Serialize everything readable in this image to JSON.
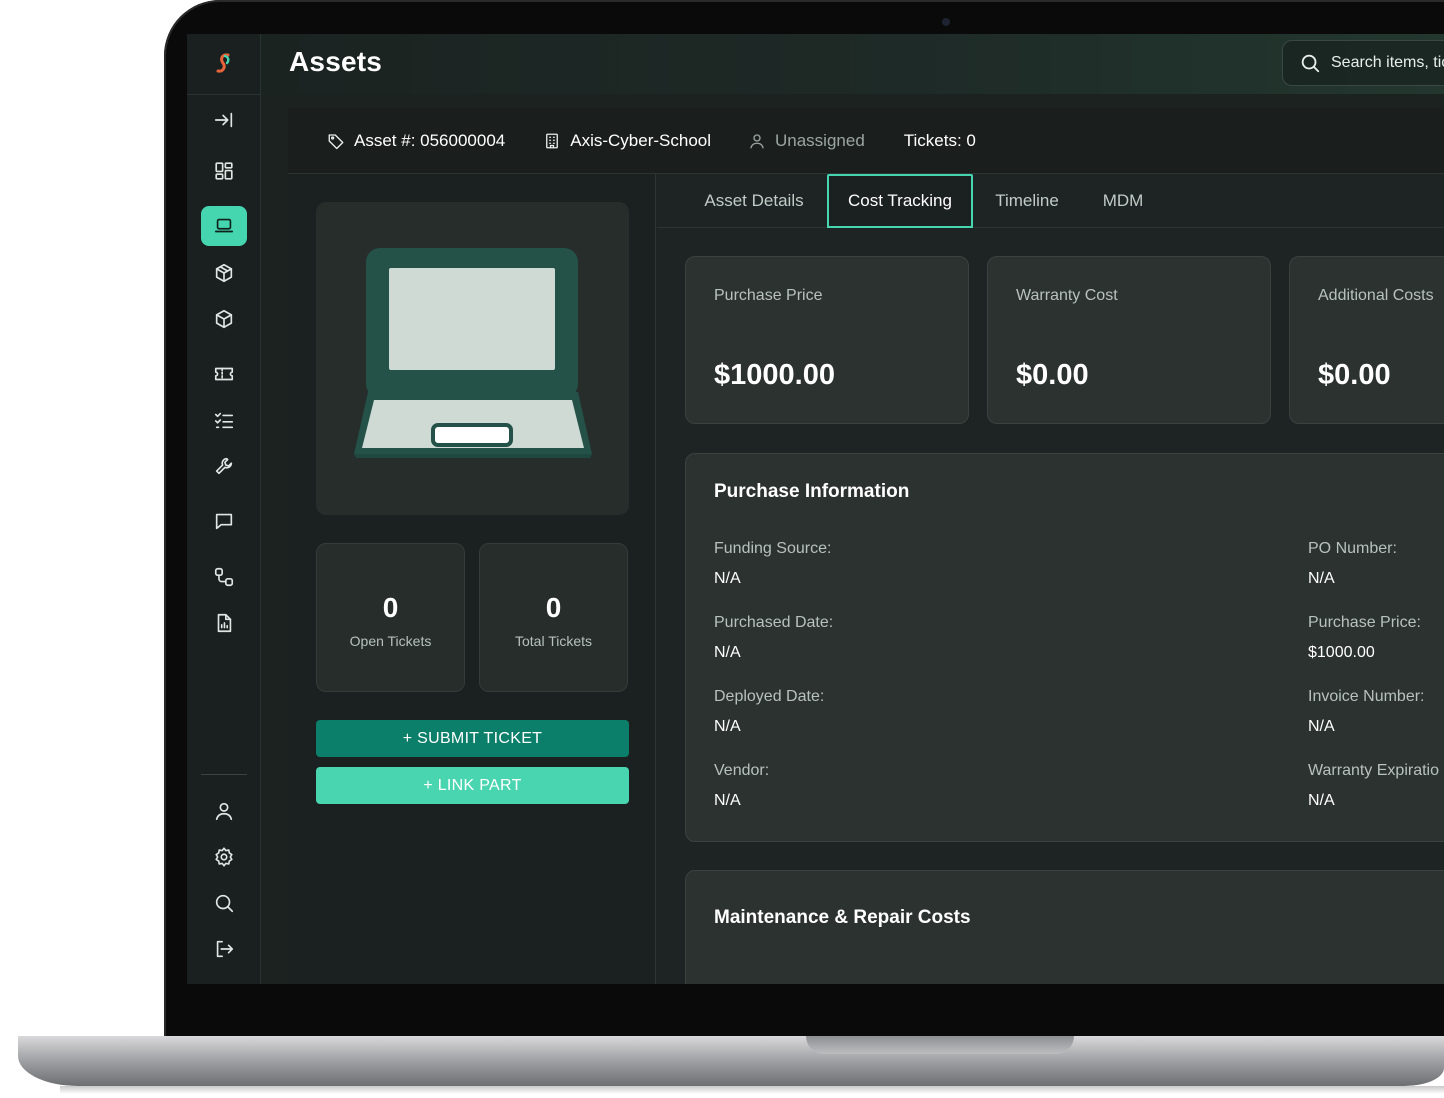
{
  "page": {
    "title": "Assets"
  },
  "search": {
    "placeholder": "Search items, tickets, pe"
  },
  "asset": {
    "number_label": "Asset #: 056000004",
    "location": "Axis-Cyber-School",
    "assignee": "Unassigned",
    "tickets_label": "Tickets: 0"
  },
  "stats": [
    {
      "value": "0",
      "label": "Open Tickets"
    },
    {
      "value": "0",
      "label": "Total Tickets"
    }
  ],
  "actions": {
    "submit_ticket": "+ SUBMIT TICKET",
    "link_part": "+ LINK PART"
  },
  "tabs": [
    {
      "label": "Asset Details",
      "active": false
    },
    {
      "label": "Cost Tracking",
      "active": true
    },
    {
      "label": "Timeline",
      "active": false
    },
    {
      "label": "MDM",
      "active": false
    }
  ],
  "costs": [
    {
      "label": "Purchase Price",
      "value": "$1000.00"
    },
    {
      "label": "Warranty Cost",
      "value": "$0.00"
    },
    {
      "label": "Additional Costs",
      "value": "$0.00"
    }
  ],
  "purchase_info": {
    "title": "Purchase Information",
    "left_fields": [
      {
        "label": "Funding Source:",
        "value": "N/A"
      },
      {
        "label": "Purchased Date:",
        "value": "N/A"
      },
      {
        "label": "Deployed Date:",
        "value": "N/A"
      },
      {
        "label": "Vendor:",
        "value": "N/A"
      }
    ],
    "right_fields": [
      {
        "label": "PO Number:",
        "value": "N/A"
      },
      {
        "label": "Purchase Price:",
        "value": "$1000.00"
      },
      {
        "label": "Invoice Number:",
        "value": "N/A"
      },
      {
        "label": "Warranty Expiratio",
        "value": "N/A"
      }
    ]
  },
  "maintenance": {
    "title": "Maintenance & Repair Costs"
  },
  "sidebar": {
    "top_icons": [
      "collapse-sidebar-icon",
      "dashboard-icon",
      "laptop-icon",
      "box-icon",
      "box-icon",
      "ticket-icon",
      "checklist-icon",
      "wrench-icon",
      "message-icon",
      "workflow-icon",
      "report-icon"
    ],
    "bottom_icons": [
      "user-icon",
      "gear-icon",
      "search-icon",
      "logout-icon"
    ]
  },
  "colors": {
    "accent": "#45d6b0",
    "submit_button": "#0b7f69",
    "link_button": "#4ad5b1",
    "logo_orange": "#e8643a"
  }
}
